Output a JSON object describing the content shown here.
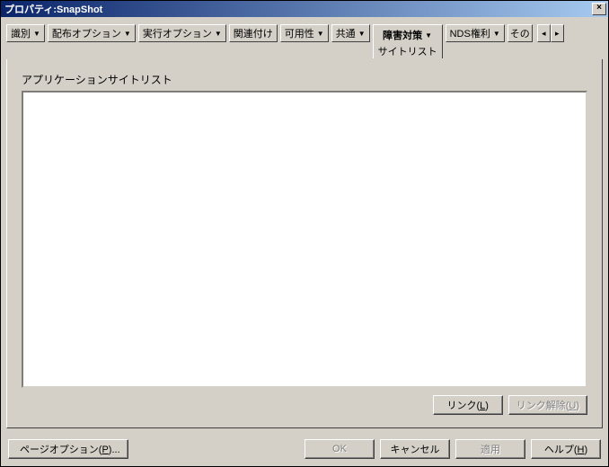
{
  "window": {
    "title": "プロパティ:SnapShot"
  },
  "tabs": {
    "t0": "識別",
    "t1": "配布オプション",
    "t2": "実行オプション",
    "t3": "関連付け",
    "t4": "可用性",
    "t5": "共通",
    "t6": "障害対策",
    "t6_sub": "サイトリスト",
    "t7": "NDS権利",
    "t8": "その"
  },
  "panel": {
    "label": "アプリケーションサイトリスト",
    "link_btn": "リンク(L)",
    "unlink_btn": "リンク解除(U)"
  },
  "buttons": {
    "page_options": "ページオプション(P)...",
    "ok": "OK",
    "cancel": "キャンセル",
    "apply": "適用",
    "help": "ヘルプ(H)"
  }
}
